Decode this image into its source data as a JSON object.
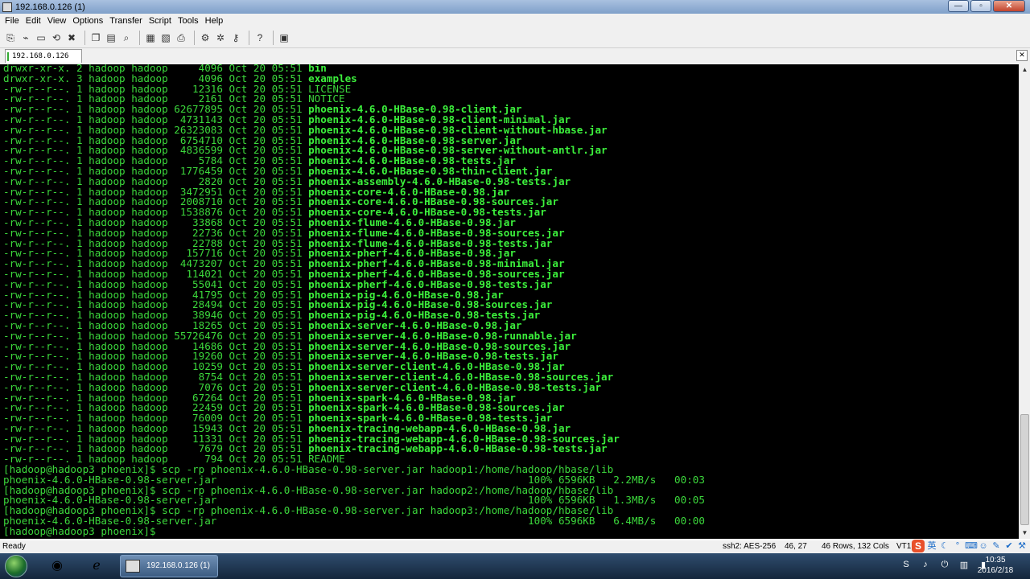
{
  "window": {
    "title": "192.168.0.126 (1)",
    "minimize_label": "—",
    "maximize_label": "▫",
    "close_label": "✕"
  },
  "menu": [
    "File",
    "Edit",
    "View",
    "Options",
    "Transfer",
    "Script",
    "Tools",
    "Help"
  ],
  "tab": {
    "label": "192.168.0.126 (1)",
    "close_label": "✕"
  },
  "terminal": {
    "lines": [
      [
        "drwxr-xr-x. 2 hadoop hadoop     4096 Oct 20 05:51 ",
        "bin"
      ],
      [
        "drwxr-xr-x. 3 hadoop hadoop     4096 Oct 20 05:51 ",
        "examples"
      ],
      [
        "-rw-r--r--. 1 hadoop hadoop    12316 Oct 20 05:51 LICENSE",
        ""
      ],
      [
        "-rw-r--r--. 1 hadoop hadoop     2161 Oct 20 05:51 NOTICE",
        ""
      ],
      [
        "-rw-r--r--. 1 hadoop hadoop 62677895 Oct 20 05:51 ",
        "phoenix-4.6.0-HBase-0.98-client.jar"
      ],
      [
        "-rw-r--r--. 1 hadoop hadoop  4731143 Oct 20 05:51 ",
        "phoenix-4.6.0-HBase-0.98-client-minimal.jar"
      ],
      [
        "-rw-r--r--. 1 hadoop hadoop 26323083 Oct 20 05:51 ",
        "phoenix-4.6.0-HBase-0.98-client-without-hbase.jar"
      ],
      [
        "-rw-r--r--. 1 hadoop hadoop  6754710 Oct 20 05:51 ",
        "phoenix-4.6.0-HBase-0.98-server.jar"
      ],
      [
        "-rw-r--r--. 1 hadoop hadoop  4836599 Oct 20 05:51 ",
        "phoenix-4.6.0-HBase-0.98-server-without-antlr.jar"
      ],
      [
        "-rw-r--r--. 1 hadoop hadoop     5784 Oct 20 05:51 ",
        "phoenix-4.6.0-HBase-0.98-tests.jar"
      ],
      [
        "-rw-r--r--. 1 hadoop hadoop  1776459 Oct 20 05:51 ",
        "phoenix-4.6.0-HBase-0.98-thin-client.jar"
      ],
      [
        "-rw-r--r--. 1 hadoop hadoop     2820 Oct 20 05:51 ",
        "phoenix-assembly-4.6.0-HBase-0.98-tests.jar"
      ],
      [
        "-rw-r--r--. 1 hadoop hadoop  3472951 Oct 20 05:51 ",
        "phoenix-core-4.6.0-HBase-0.98.jar"
      ],
      [
        "-rw-r--r--. 1 hadoop hadoop  2008710 Oct 20 05:51 ",
        "phoenix-core-4.6.0-HBase-0.98-sources.jar"
      ],
      [
        "-rw-r--r--. 1 hadoop hadoop  1538876 Oct 20 05:51 ",
        "phoenix-core-4.6.0-HBase-0.98-tests.jar"
      ],
      [
        "-rw-r--r--. 1 hadoop hadoop    33868 Oct 20 05:51 ",
        "phoenix-flume-4.6.0-HBase-0.98.jar"
      ],
      [
        "-rw-r--r--. 1 hadoop hadoop    22736 Oct 20 05:51 ",
        "phoenix-flume-4.6.0-HBase-0.98-sources.jar"
      ],
      [
        "-rw-r--r--. 1 hadoop hadoop    22788 Oct 20 05:51 ",
        "phoenix-flume-4.6.0-HBase-0.98-tests.jar"
      ],
      [
        "-rw-r--r--. 1 hadoop hadoop   157716 Oct 20 05:51 ",
        "phoenix-pherf-4.6.0-HBase-0.98.jar"
      ],
      [
        "-rw-r--r--. 1 hadoop hadoop  4473207 Oct 20 05:51 ",
        "phoenix-pherf-4.6.0-HBase-0.98-minimal.jar"
      ],
      [
        "-rw-r--r--. 1 hadoop hadoop   114021 Oct 20 05:51 ",
        "phoenix-pherf-4.6.0-HBase-0.98-sources.jar"
      ],
      [
        "-rw-r--r--. 1 hadoop hadoop    55041 Oct 20 05:51 ",
        "phoenix-pherf-4.6.0-HBase-0.98-tests.jar"
      ],
      [
        "-rw-r--r--. 1 hadoop hadoop    41795 Oct 20 05:51 ",
        "phoenix-pig-4.6.0-HBase-0.98.jar"
      ],
      [
        "-rw-r--r--. 1 hadoop hadoop    28494 Oct 20 05:51 ",
        "phoenix-pig-4.6.0-HBase-0.98-sources.jar"
      ],
      [
        "-rw-r--r--. 1 hadoop hadoop    38946 Oct 20 05:51 ",
        "phoenix-pig-4.6.0-HBase-0.98-tests.jar"
      ],
      [
        "-rw-r--r--. 1 hadoop hadoop    18265 Oct 20 05:51 ",
        "phoenix-server-4.6.0-HBase-0.98.jar"
      ],
      [
        "-rw-r--r--. 1 hadoop hadoop 55726476 Oct 20 05:51 ",
        "phoenix-server-4.6.0-HBase-0.98-runnable.jar"
      ],
      [
        "-rw-r--r--. 1 hadoop hadoop    14686 Oct 20 05:51 ",
        "phoenix-server-4.6.0-HBase-0.98-sources.jar"
      ],
      [
        "-rw-r--r--. 1 hadoop hadoop    19260 Oct 20 05:51 ",
        "phoenix-server-4.6.0-HBase-0.98-tests.jar"
      ],
      [
        "-rw-r--r--. 1 hadoop hadoop    10259 Oct 20 05:51 ",
        "phoenix-server-client-4.6.0-HBase-0.98.jar"
      ],
      [
        "-rw-r--r--. 1 hadoop hadoop     8754 Oct 20 05:51 ",
        "phoenix-server-client-4.6.0-HBase-0.98-sources.jar"
      ],
      [
        "-rw-r--r--. 1 hadoop hadoop     7076 Oct 20 05:51 ",
        "phoenix-server-client-4.6.0-HBase-0.98-tests.jar"
      ],
      [
        "-rw-r--r--. 1 hadoop hadoop    67264 Oct 20 05:51 ",
        "phoenix-spark-4.6.0-HBase-0.98.jar"
      ],
      [
        "-rw-r--r--. 1 hadoop hadoop    22459 Oct 20 05:51 ",
        "phoenix-spark-4.6.0-HBase-0.98-sources.jar"
      ],
      [
        "-rw-r--r--. 1 hadoop hadoop    76009 Oct 20 05:51 ",
        "phoenix-spark-4.6.0-HBase-0.98-tests.jar"
      ],
      [
        "-rw-r--r--. 1 hadoop hadoop    15943 Oct 20 05:51 ",
        "phoenix-tracing-webapp-4.6.0-HBase-0.98.jar"
      ],
      [
        "-rw-r--r--. 1 hadoop hadoop    11331 Oct 20 05:51 ",
        "phoenix-tracing-webapp-4.6.0-HBase-0.98-sources.jar"
      ],
      [
        "-rw-r--r--. 1 hadoop hadoop     7679 Oct 20 05:51 ",
        "phoenix-tracing-webapp-4.6.0-HBase-0.98-tests.jar"
      ],
      [
        "-rw-r--r--. 1 hadoop hadoop      794 Oct 20 05:51 README",
        ""
      ],
      [
        "[hadoop@hadoop3 phoenix]$ scp -rp phoenix-4.6.0-HBase-0.98-server.jar hadoop1:/home/hadoop/hbase/lib",
        ""
      ],
      [
        "phoenix-4.6.0-HBase-0.98-server.jar                                                   100% 6596KB   2.2MB/s   00:03",
        ""
      ],
      [
        "[hadoop@hadoop3 phoenix]$ scp -rp phoenix-4.6.0-HBase-0.98-server.jar hadoop2:/home/hadoop/hbase/lib",
        ""
      ],
      [
        "phoenix-4.6.0-HBase-0.98-server.jar                                                   100% 6596KB   1.3MB/s   00:05",
        ""
      ],
      [
        "[hadoop@hadoop3 phoenix]$ scp -rp phoenix-4.6.0-HBase-0.98-server.jar hadoop3:/home/hadoop/hbase/lib",
        ""
      ],
      [
        "phoenix-4.6.0-HBase-0.98-server.jar                                                   100% 6596KB   6.4MB/s   00:00",
        ""
      ],
      [
        "[hadoop@hadoop3 phoenix]$",
        ""
      ]
    ]
  },
  "status": {
    "ready": "Ready",
    "cipher": "ssh2: AES-256",
    "cursor": "46,  27",
    "size": "46 Rows, 132 Cols",
    "emulation": "VT1"
  },
  "ime": {
    "logo": "S",
    "lang": "英"
  },
  "taskbar": {
    "window_label": "192.168.0.126 (1)",
    "time": "10:35",
    "date": "2016/2/18"
  },
  "colors": {
    "terminal_bg": "#000000",
    "terminal_fg": "#3cd83c"
  }
}
